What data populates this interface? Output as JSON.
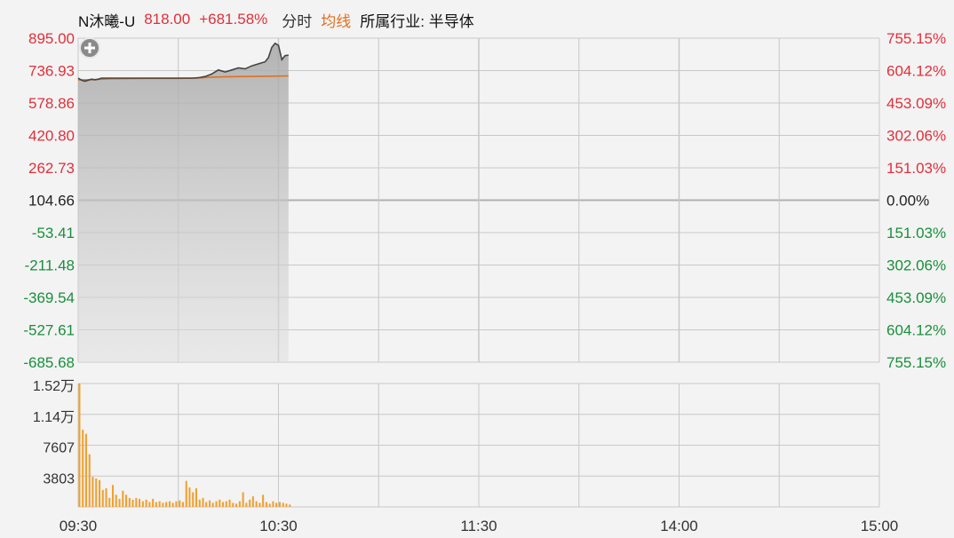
{
  "header": {
    "name": "N沐曦-U",
    "price": "818.00",
    "change": "+681.58%",
    "mode": "分时",
    "avg_label": "均线",
    "industry": "所属行业: 半导体"
  },
  "colors": {
    "up": "#e0303a",
    "down": "#1a8f3c",
    "price_line": "#444444",
    "avg_line": "#e07020",
    "volume_bar": "#f0a030",
    "grid": "#c8c8c8",
    "mode_text": "#333333",
    "avg_text": "#e07020"
  },
  "chart_data": [
    {
      "type": "line",
      "title": "",
      "y_left_ticks": [
        "895.00",
        "736.93",
        "578.86",
        "420.80",
        "262.73",
        "104.66",
        "-53.41",
        "-211.48",
        "-369.54",
        "-527.61",
        "-685.68"
      ],
      "y_right_ticks": [
        "755.15%",
        "604.12%",
        "453.09%",
        "302.06%",
        "151.03%",
        "0.00%",
        "151.03%",
        "302.06%",
        "453.09%",
        "604.12%",
        "755.15%"
      ],
      "ylim": [
        -685.68,
        895.0
      ],
      "base": 104.66,
      "x_labels": [
        "09:30",
        "10:30",
        "11:30",
        "14:00",
        "15:00"
      ],
      "x_minutes": [
        0,
        240
      ],
      "series": [
        {
          "key": "price",
          "x": [
            0,
            1,
            2,
            3,
            4,
            5,
            6,
            7,
            8,
            10,
            12,
            14,
            16,
            18,
            20,
            22,
            24,
            26,
            28,
            30,
            32,
            34,
            36,
            38,
            40,
            42,
            44,
            46,
            48,
            50,
            52,
            54,
            56,
            57,
            58,
            59,
            60,
            61,
            62,
            63
          ],
          "values": [
            700,
            690,
            685,
            690,
            695,
            692,
            695,
            700,
            700,
            700,
            700,
            700,
            700,
            700,
            700,
            700,
            700,
            700,
            700,
            700,
            700,
            700,
            702,
            708,
            720,
            740,
            730,
            740,
            750,
            745,
            760,
            770,
            780,
            800,
            850,
            870,
            860,
            790,
            810,
            812
          ]
        },
        {
          "key": "avg",
          "x": [
            0,
            3,
            10,
            20,
            30,
            35,
            37,
            40,
            45,
            50,
            55,
            60,
            63
          ],
          "values": [
            692,
            692,
            697,
            699,
            699,
            700,
            702,
            705,
            707,
            708,
            709,
            710,
            711
          ]
        }
      ]
    },
    {
      "type": "bar",
      "title": "",
      "y_ticks": [
        "1.52万",
        "1.14万",
        "7607",
        "3803"
      ],
      "ylim": [
        0,
        15200
      ],
      "x": [
        0,
        1,
        2,
        3,
        4,
        5,
        6,
        7,
        8,
        9,
        10,
        11,
        12,
        13,
        14,
        15,
        16,
        17,
        18,
        19,
        20,
        21,
        22,
        23,
        24,
        25,
        26,
        27,
        28,
        29,
        30,
        31,
        32,
        33,
        34,
        35,
        36,
        37,
        38,
        39,
        40,
        41,
        42,
        43,
        44,
        45,
        46,
        47,
        48,
        49,
        50,
        51,
        52,
        53,
        54,
        55,
        56,
        57,
        58,
        59,
        60,
        61,
        62,
        63
      ],
      "values": [
        15200,
        9500,
        9000,
        6500,
        3700,
        3500,
        3300,
        2100,
        2300,
        1100,
        2700,
        1500,
        1000,
        2000,
        1500,
        1100,
        900,
        1100,
        1000,
        700,
        900,
        600,
        1000,
        600,
        700,
        500,
        600,
        700,
        500,
        700,
        800,
        600,
        3200,
        2400,
        1800,
        2300,
        900,
        1100,
        600,
        800,
        500,
        700,
        900,
        600,
        700,
        900,
        500,
        400,
        700,
        1800,
        500,
        900,
        1300,
        700,
        500,
        1500,
        600,
        400,
        700,
        500,
        600,
        500,
        400,
        300
      ]
    }
  ]
}
